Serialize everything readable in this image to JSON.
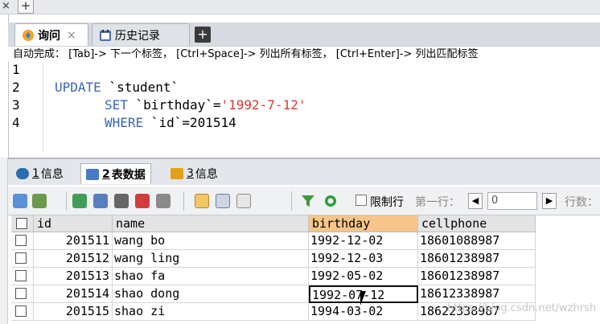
{
  "topbar": {
    "close_glyph": "×",
    "plus_glyph": "+"
  },
  "editor": {
    "tabs": [
      {
        "label": "询问",
        "icon": "query-icon",
        "close": "×"
      },
      {
        "label": "历史记录",
        "icon": "history-icon"
      }
    ],
    "add_tab": "+",
    "hint": "自动完成： [Tab]-> 下一个标签， [Ctrl+Space]-> 列出所有标签， [Ctrl+Enter]-> 列出匹配标签",
    "line_numbers": [
      "1",
      "2",
      "3",
      "4"
    ],
    "code": {
      "l2_kw": "UPDATE",
      "l2_rest": " `student`",
      "l3_kw": "SET",
      "l3_mid": " `birthday`=",
      "l3_str": "'1992-7-12'",
      "l4_kw": "WHERE",
      "l4_rest": " `id`=201514"
    }
  },
  "results": {
    "tabs": [
      {
        "num": "1",
        "label": "信息",
        "icon": "info-icon"
      },
      {
        "num": "2",
        "label": "表数据",
        "icon": "table-icon"
      },
      {
        "num": "3",
        "label": "信息",
        "icon": "info-icon"
      }
    ],
    "toolbar": {
      "limit_label": "限制行",
      "first_row_label": "第一行：",
      "first_row_value": "0",
      "rows_label": "行数："
    },
    "columns": [
      "id",
      "name",
      "birthday",
      "cellphone"
    ],
    "rows": [
      {
        "id": "201511",
        "name": "wang bo",
        "birthday": "1992-12-02",
        "cellphone": "18601088987"
      },
      {
        "id": "201512",
        "name": "wang ling",
        "birthday": "1992-12-03",
        "cellphone": "18601238987"
      },
      {
        "id": "201513",
        "name": "shao fa",
        "birthday": "1992-05-02",
        "cellphone": "18601238987"
      },
      {
        "id": "201514",
        "name": "shao dong",
        "birthday": "1992-07-12",
        "cellphone": "18612338987"
      },
      {
        "id": "201515",
        "name": "shao zi",
        "birthday": "1994-03-02",
        "cellphone": "18622338987"
      }
    ],
    "watermark": "https://blog.csdn.net/wzhrsh"
  },
  "colors": {
    "keyword": "#3b66b8",
    "string": "#d23a2c",
    "selected_header": "#f5c58a"
  }
}
